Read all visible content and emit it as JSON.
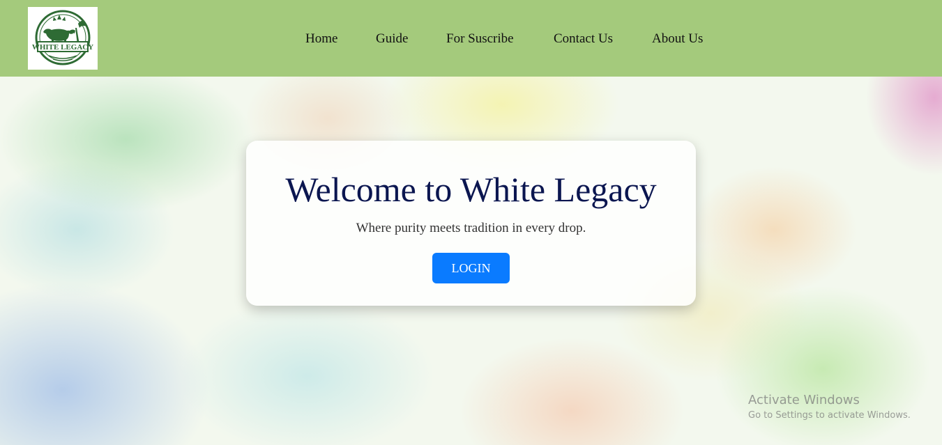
{
  "brand": {
    "logo_text": "WHITE LEGACY",
    "colors": {
      "navbar": "#a4ca7c",
      "logo_green": "#2e6b34",
      "title": "#0b1650",
      "button": "#0a7bff"
    }
  },
  "nav": {
    "items": [
      {
        "label": "Home"
      },
      {
        "label": "Guide"
      },
      {
        "label": "For Suscribe"
      },
      {
        "label": "Contact Us"
      },
      {
        "label": "About Us"
      }
    ]
  },
  "hero": {
    "title": "Welcome to White Legacy",
    "subtitle": "Where purity meets tradition in every drop.",
    "login_label": "LOGIN"
  },
  "watermark": {
    "title": "Activate Windows",
    "subtitle": "Go to Settings to activate Windows."
  }
}
